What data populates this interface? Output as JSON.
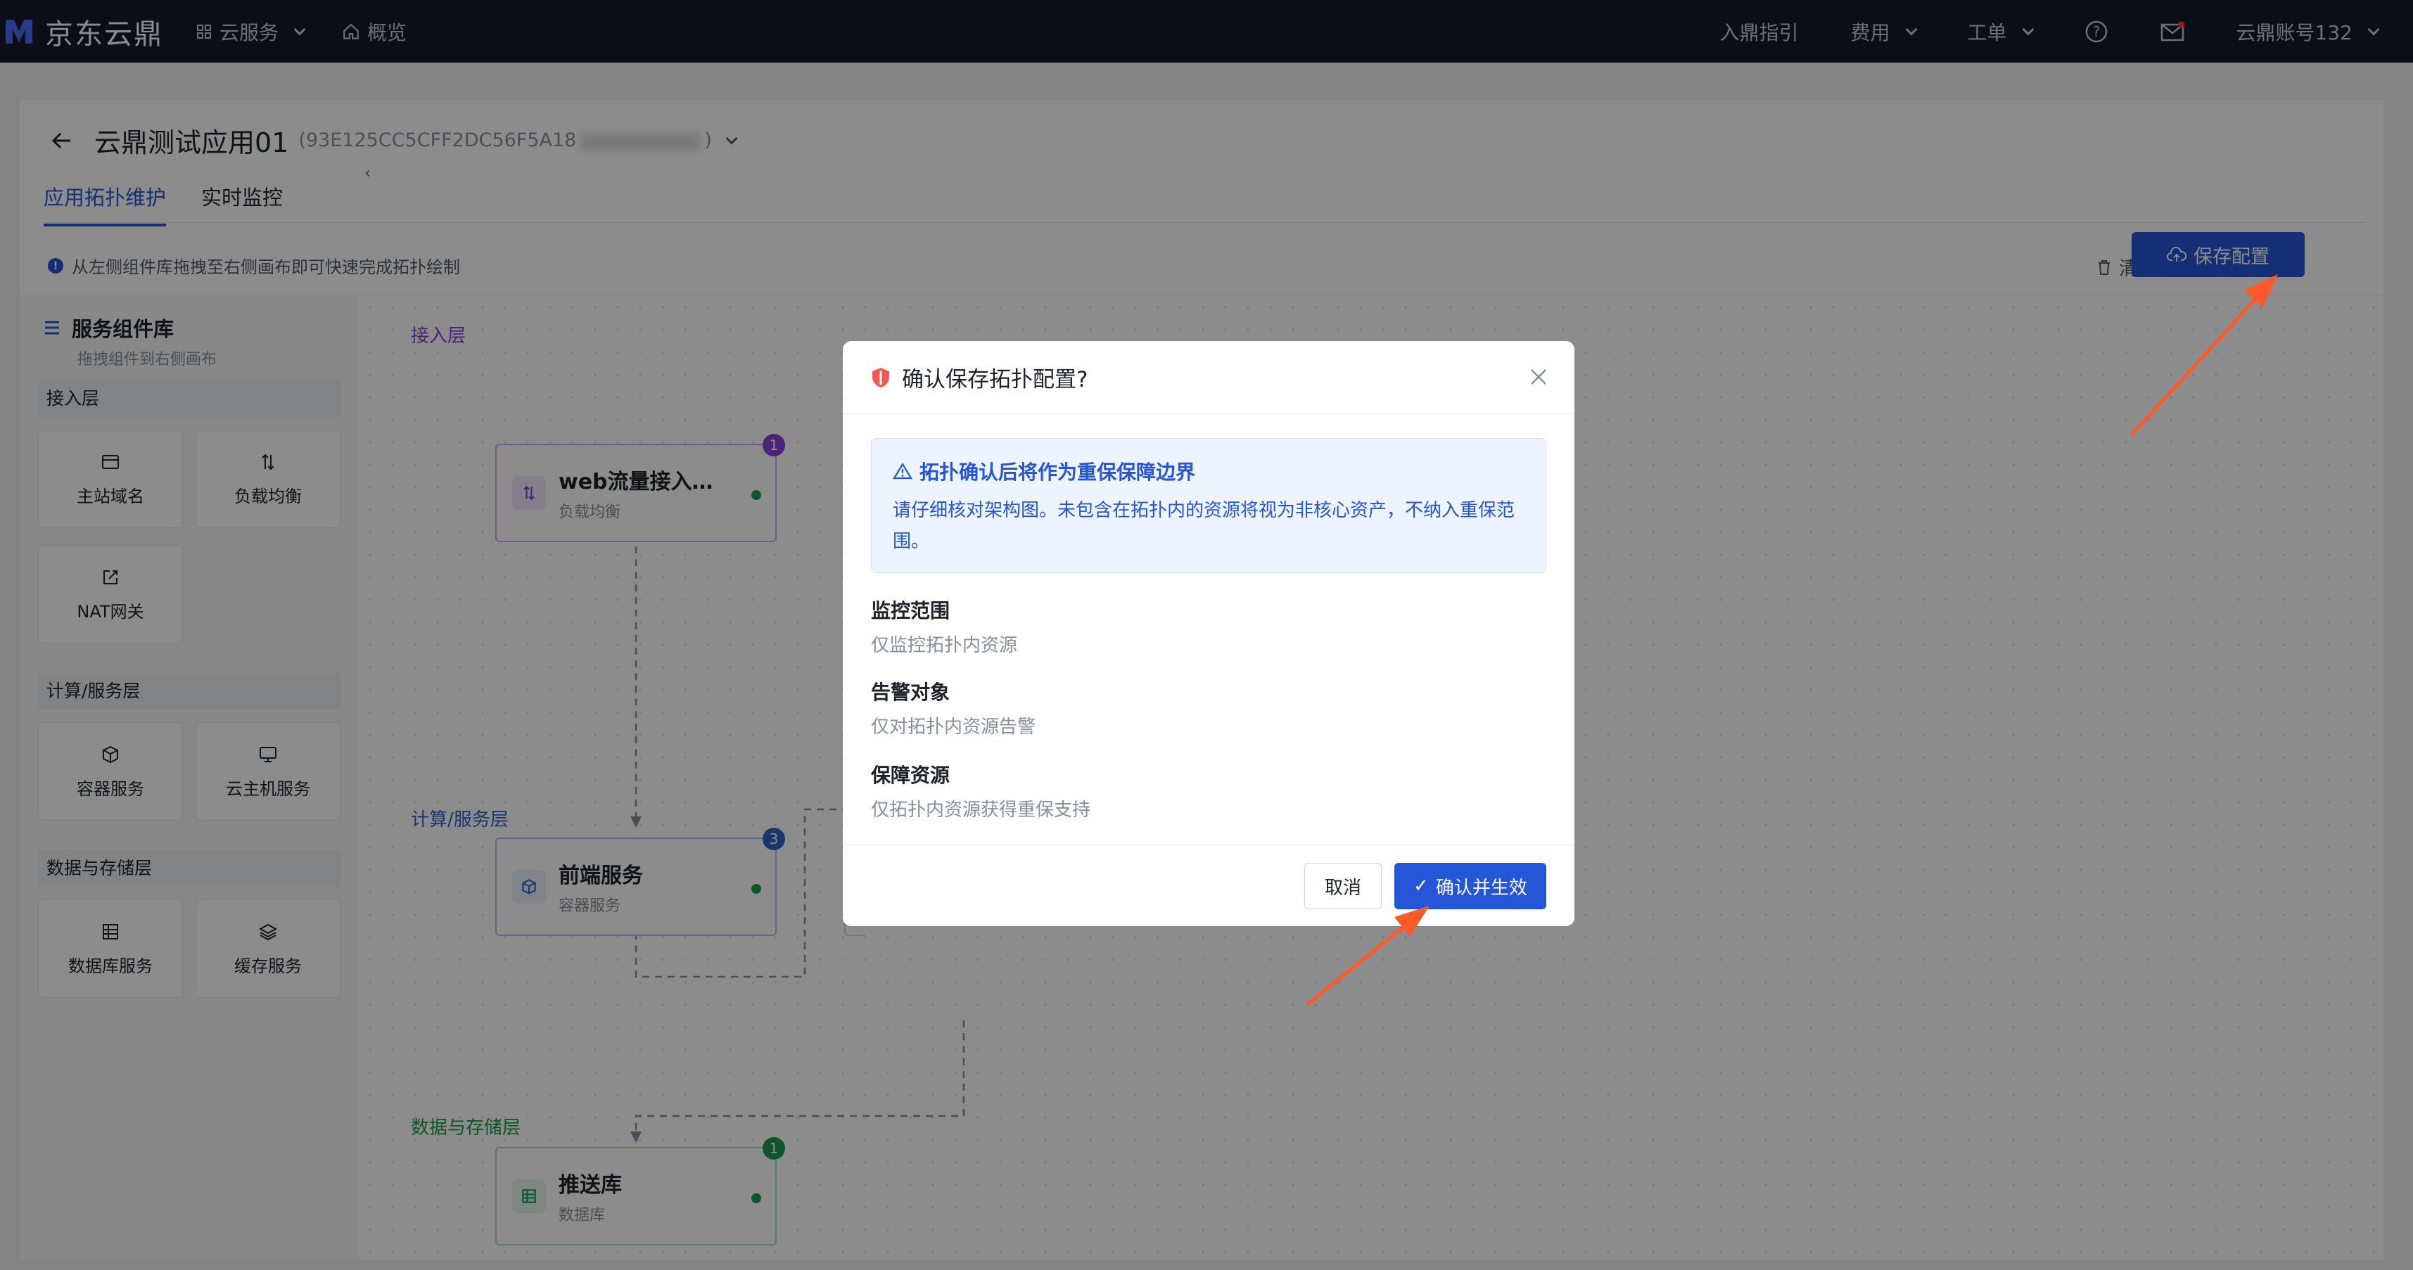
{
  "nav": {
    "brand": "京东云鼎",
    "cloud_services": "云服务",
    "overview": "概览",
    "guide": "入鼎指引",
    "fees": "费用",
    "tickets": "工单",
    "account": "云鼎账号132"
  },
  "app": {
    "title": "云鼎测试应用01",
    "id_prefix": "(93E125CC5CFF2DC56F5A18",
    "id_suffix": ")"
  },
  "tabs": [
    "应用拓扑维护",
    "实时监控"
  ],
  "toolbar": {
    "hint": "从左侧组件库拖拽至右侧画布即可快速完成拓扑绘制",
    "clear": "清空",
    "save": "保存配置"
  },
  "sidebar": {
    "title": "服务组件库",
    "subtitle": "拖拽组件到右侧画布",
    "groups": [
      {
        "label": "接入层",
        "items": [
          "主站域名",
          "负载均衡",
          "NAT网关"
        ]
      },
      {
        "label": "计算/服务层",
        "items": [
          "容器服务",
          "云主机服务"
        ]
      },
      {
        "label": "数据与存储层",
        "items": [
          "数据库服务",
          "缓存服务"
        ]
      }
    ]
  },
  "canvas": {
    "layers": [
      "接入层",
      "计算/服务层",
      "数据与存储层"
    ],
    "nodes": [
      {
        "title": "web流量接入…",
        "sub": "负载均衡",
        "badge": "1"
      },
      {
        "title": "前端服务",
        "sub": "容器服务",
        "badge": "3"
      },
      {
        "title": "推送库",
        "sub": "数据库",
        "badge": "1"
      }
    ]
  },
  "modal": {
    "title": "确认保存拓扑配置?",
    "alert_title": "拓扑确认后将作为重保保障边界",
    "alert_text": "请仔细核对架构图。未包含在拓扑内的资源将视为非核心资产，不纳入重保范围。",
    "fields": [
      {
        "label": "监控范围",
        "value": "仅监控拓扑内资源"
      },
      {
        "label": "告警对象",
        "value": "仅对拓扑内资源告警"
      },
      {
        "label": "保障资源",
        "value": "仅拓扑内资源获得重保支持"
      }
    ],
    "cancel": "取消",
    "confirm": "确认并生效"
  },
  "colors": {
    "primary": "#2556d8",
    "topbar": "#151b2b",
    "access_layer": "#8b3fd9",
    "compute_layer": "#2f64c9",
    "data_layer": "#1a9c4c",
    "annotation_arrow": "#ff5a2a"
  }
}
